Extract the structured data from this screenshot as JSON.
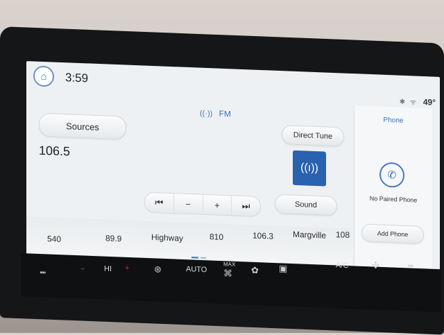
{
  "status": {
    "home_icon": "home-icon",
    "time": "3:59",
    "temperature": "49°"
  },
  "radio": {
    "band": "FM",
    "frequency": "106.5",
    "sources_label": "Sources",
    "direct_tune_label": "Direct Tune",
    "sound_label": "Sound",
    "controls": {
      "seek_back": "⏮",
      "minus": "−",
      "plus": "+",
      "seek_forward": "⏭"
    },
    "presets": [
      "540",
      "89.9",
      "Highway",
      "810",
      "106.3",
      "Margville",
      "108"
    ]
  },
  "phone": {
    "title": "Phone",
    "status": "No Paired Phone",
    "add_label": "Add Phone"
  },
  "climate": {
    "fan_label": "HI",
    "auto_label": "AUTO",
    "max_label": "MAX",
    "ac_label": "A/C"
  },
  "colors": {
    "accent": "#3c6fb8",
    "tile": "#2a62b0",
    "heat_red": "#d8313a",
    "cool_blue": "#3a63c9"
  }
}
